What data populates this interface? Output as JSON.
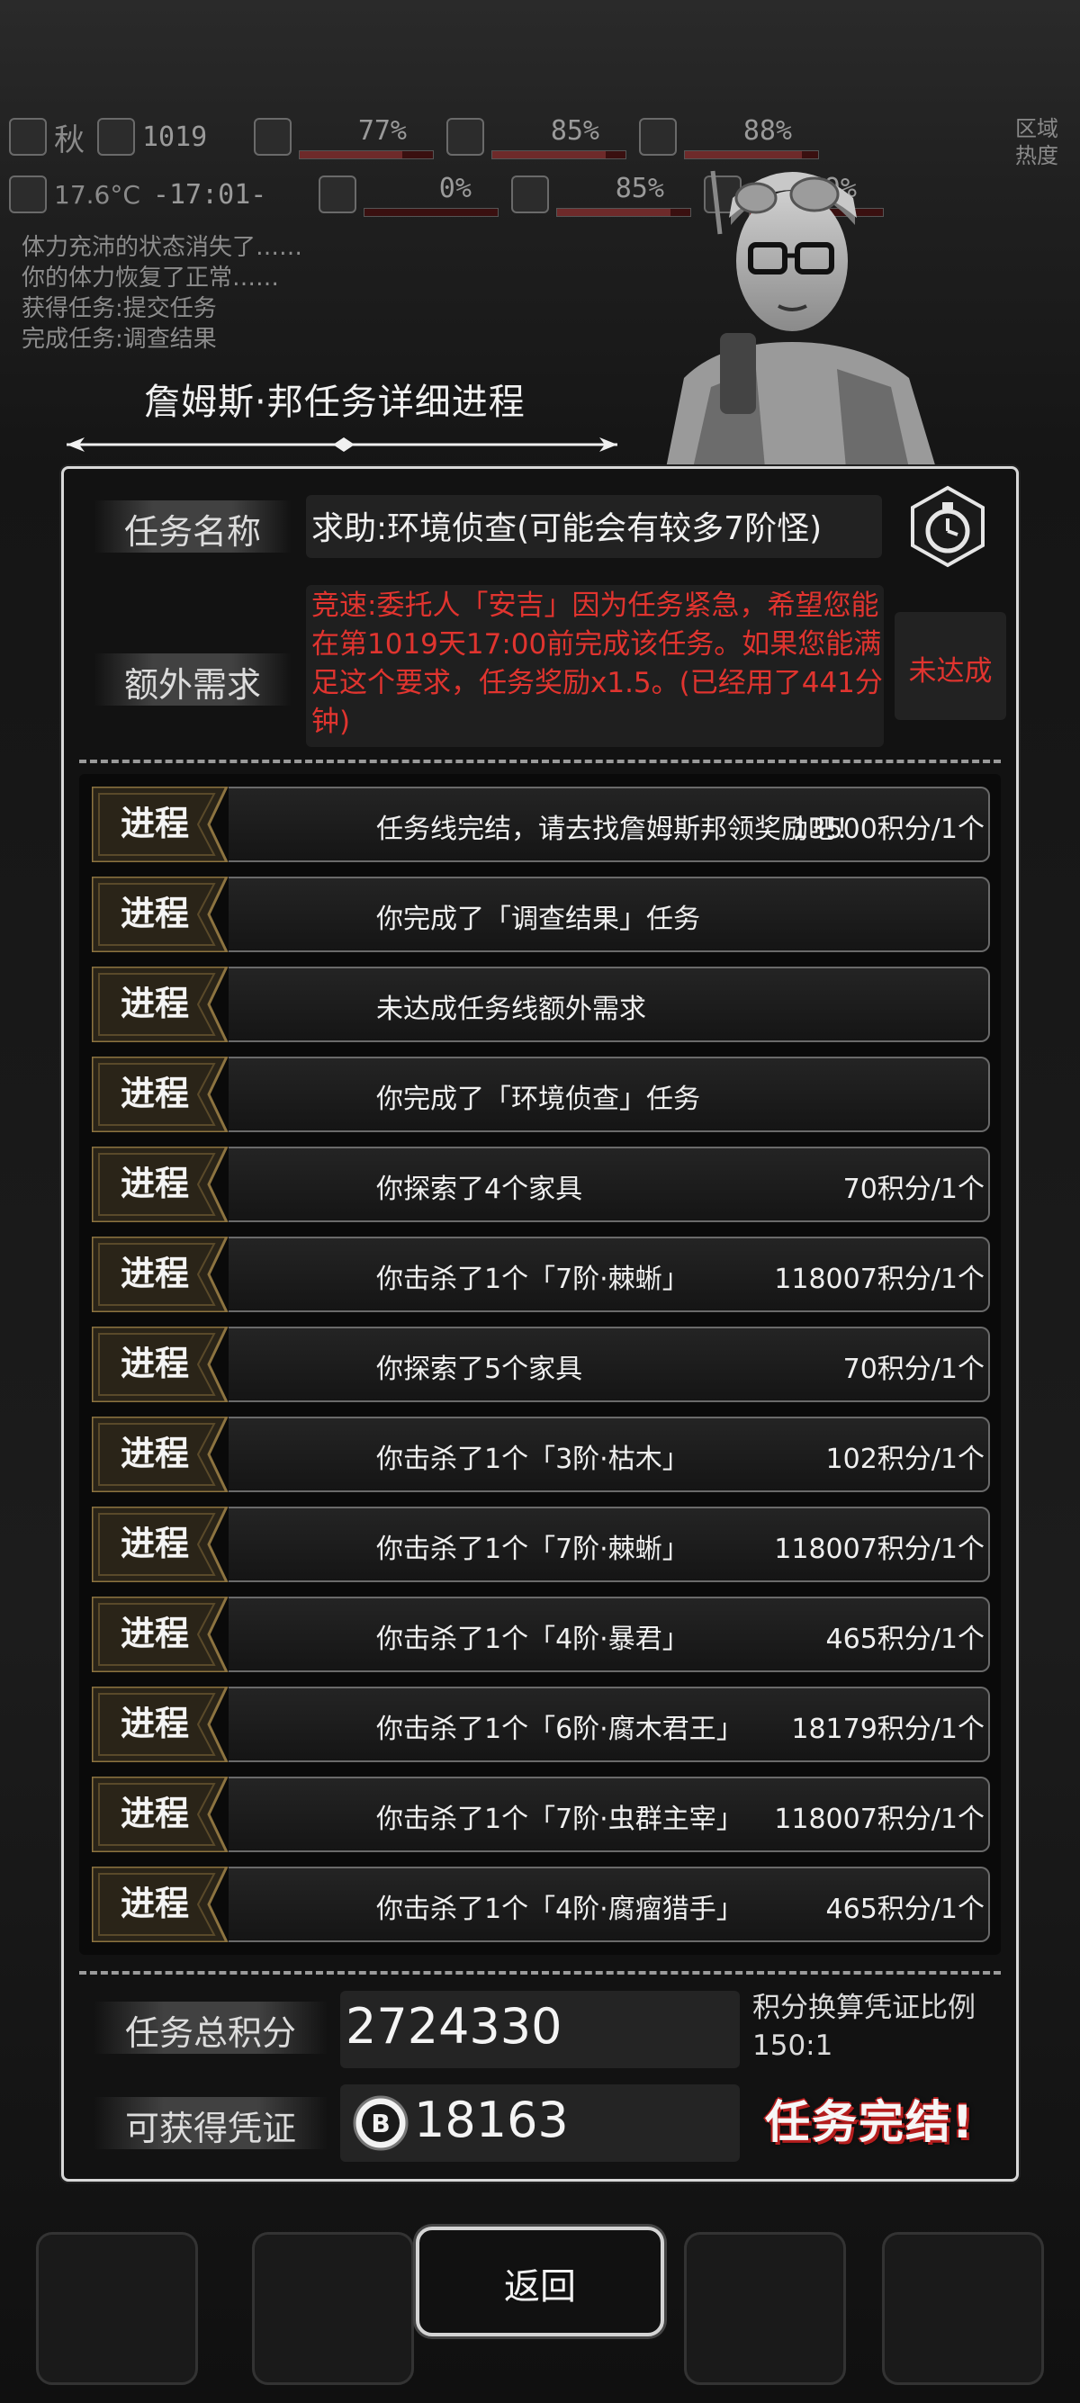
{
  "hud": {
    "season": "秋",
    "day": "1019",
    "temperature": "17.6°C",
    "time": "-17:01-",
    "stats_top": [
      "77%",
      "85%",
      "88%"
    ],
    "stats_bottom": [
      "0%",
      "85%",
      "49%"
    ],
    "heat_label": "区域热度"
  },
  "log": [
    "体力充沛的状态消失了……",
    "你的体力恢复了正常……",
    "获得任务:提交任务",
    "完成任务:调查结果"
  ],
  "dialog": {
    "title": "詹姆斯·邦任务详细进程",
    "task_name_label": "任务名称",
    "task_name": "求助:环境侦查(可能会有较多7阶怪)",
    "extra_label": "额外需求",
    "extra_text": "竞速:委托人「安吉」因为任务紧急，希望您能在第1019天17:00前完成该任务。如果您能满足这个要求，任务奖励x1.5。(已经用了441分钟)",
    "extra_status": "未达成",
    "progress_tag": "进程",
    "progress": [
      {
        "desc": "任务线完结，请去找詹姆斯邦领奖励吧！",
        "points": "13500积分/1个"
      },
      {
        "desc": "你完成了「调查结果」任务",
        "points": ""
      },
      {
        "desc": "未达成任务线额外需求",
        "points": ""
      },
      {
        "desc": "你完成了「环境侦查」任务",
        "points": ""
      },
      {
        "desc": "你探索了4个家具",
        "points": "70积分/1个"
      },
      {
        "desc": "你击杀了1个「7阶·棘蜥」",
        "points": "118007积分/1个"
      },
      {
        "desc": "你探索了5个家具",
        "points": "70积分/1个"
      },
      {
        "desc": "你击杀了1个「3阶·枯木」",
        "points": "102积分/1个"
      },
      {
        "desc": "你击杀了1个「7阶·棘蜥」",
        "points": "118007积分/1个"
      },
      {
        "desc": "你击杀了1个「4阶·暴君」",
        "points": "465积分/1个"
      },
      {
        "desc": "你击杀了1个「6阶·腐木君王」",
        "points": "18179积分/1个"
      },
      {
        "desc": "你击杀了1个「7阶·虫群主宰」",
        "points": "118007积分/1个"
      },
      {
        "desc": "你击杀了1个「4阶·腐瘤猎手」",
        "points": "465积分/1个"
      }
    ],
    "total_label": "任务总积分",
    "total_value": "2724330",
    "ratio_label": "积分换算凭证比例",
    "ratio_value": "150:1",
    "voucher_label": "可获得凭证",
    "voucher_value": "18163",
    "completed_stamp": "任务完结!",
    "back_button": "返回"
  },
  "colors": {
    "warning": "#e0342f",
    "panel_border": "#d8d8d8",
    "tag_gold": "#8c7340"
  }
}
